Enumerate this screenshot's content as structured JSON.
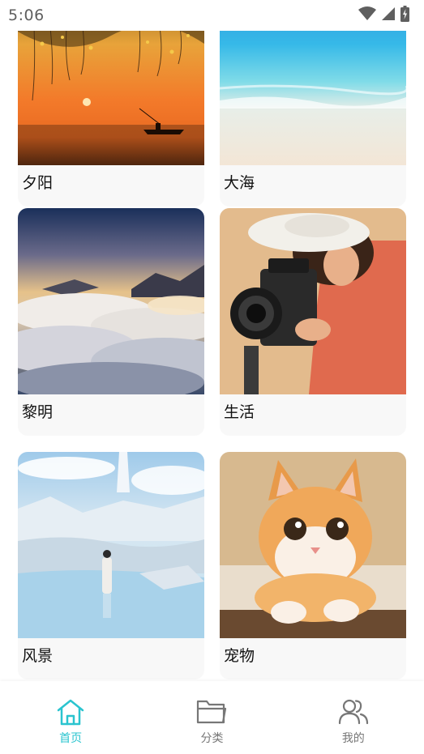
{
  "status_bar": {
    "time": "5:06"
  },
  "cards": [
    {
      "label": "夕阳"
    },
    {
      "label": "大海"
    },
    {
      "label": "黎明"
    },
    {
      "label": "生活"
    },
    {
      "label": "风景"
    },
    {
      "label": "宠物"
    }
  ],
  "bottom_nav": {
    "active_color": "#2ac4cf",
    "items": [
      {
        "label": "首页",
        "icon": "home-icon",
        "active": true
      },
      {
        "label": "分类",
        "icon": "folder-icon",
        "active": false
      },
      {
        "label": "我的",
        "icon": "users-icon",
        "active": false
      }
    ]
  }
}
